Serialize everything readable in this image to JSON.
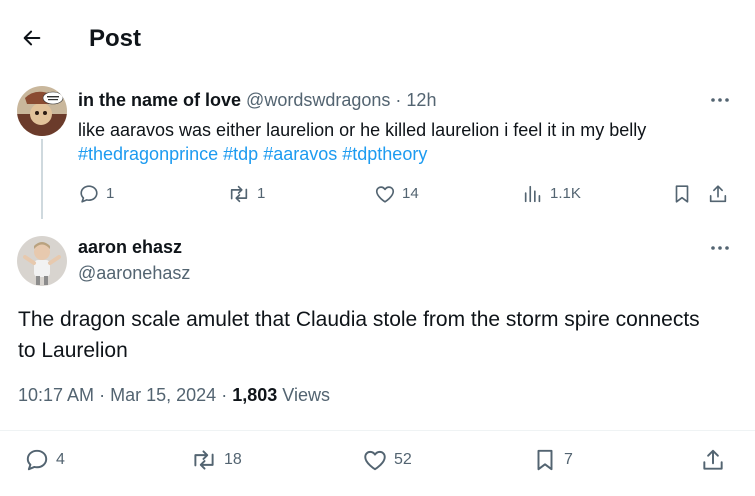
{
  "header": {
    "title": "Post"
  },
  "reply": {
    "display_name": "in the name of love",
    "handle": "@wordswdragons",
    "separator": "·",
    "time": "12h",
    "text": "like aaravos was either laurelion or he killed laurelion i feel it in my belly",
    "hashtags": [
      "#thedragonprince",
      "#tdp",
      "#aaravos",
      "#tdptheory"
    ],
    "stats": {
      "replies": "1",
      "reposts": "1",
      "likes": "14",
      "views": "1.1K"
    }
  },
  "main_post": {
    "display_name": "aaron ehasz",
    "handle": "@aaronehasz",
    "text": "The dragon scale amulet that Claudia stole from the storm spire connects to Laurelion",
    "time": "10:17 AM",
    "separator": "·",
    "date": "Mar 15, 2024",
    "views_count": "1,803",
    "views_label": "Views",
    "stats": {
      "replies": "4",
      "reposts": "18",
      "likes": "52",
      "bookmarks": "7"
    }
  },
  "icons": {
    "back": "arrow-left-icon",
    "more": "more-horizontal-icon",
    "reply": "reply-icon",
    "repost": "repost-icon",
    "like": "heart-icon",
    "views": "bar-chart-icon",
    "bookmark": "bookmark-icon",
    "share": "share-icon"
  },
  "colors": {
    "text": "#0f1419",
    "muted": "#536471",
    "link": "#1d9bf0",
    "border": "#eff3f4"
  }
}
